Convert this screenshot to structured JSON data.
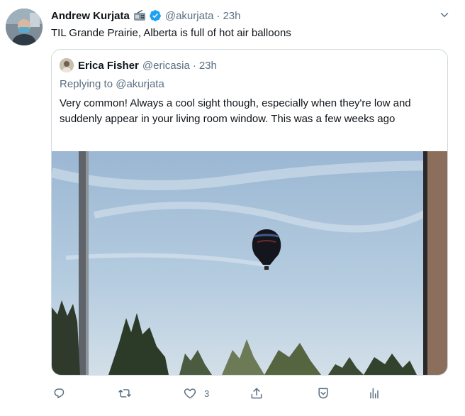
{
  "tweet": {
    "author_name": "Andrew Kurjata",
    "author_handle": "@akurjata",
    "separator": "·",
    "time": "23h",
    "text": "TIL Grande Prairie, Alberta is full of hot air balloons"
  },
  "quote": {
    "author_name": "Erica Fisher",
    "author_handle": "@ericasia",
    "separator": "·",
    "time": "23h",
    "replying_to": "Replying to @akurjata",
    "text": "Very common! Always a cool sight though, especially when they're low and suddenly appear in your living room window. This was a few weeks ago"
  },
  "actions": {
    "reply_count": "",
    "retweet_count": "",
    "like_count": "3",
    "share_label": "",
    "icons": [
      "reply-icon",
      "retweet-icon",
      "like-icon",
      "share-icon",
      "save-icon",
      "analytics-icon"
    ]
  },
  "colors": {
    "accent": "#1da1f2",
    "secondary_text": "#5b7083",
    "border": "#cfd9de",
    "sky": "#a9c3dc"
  }
}
